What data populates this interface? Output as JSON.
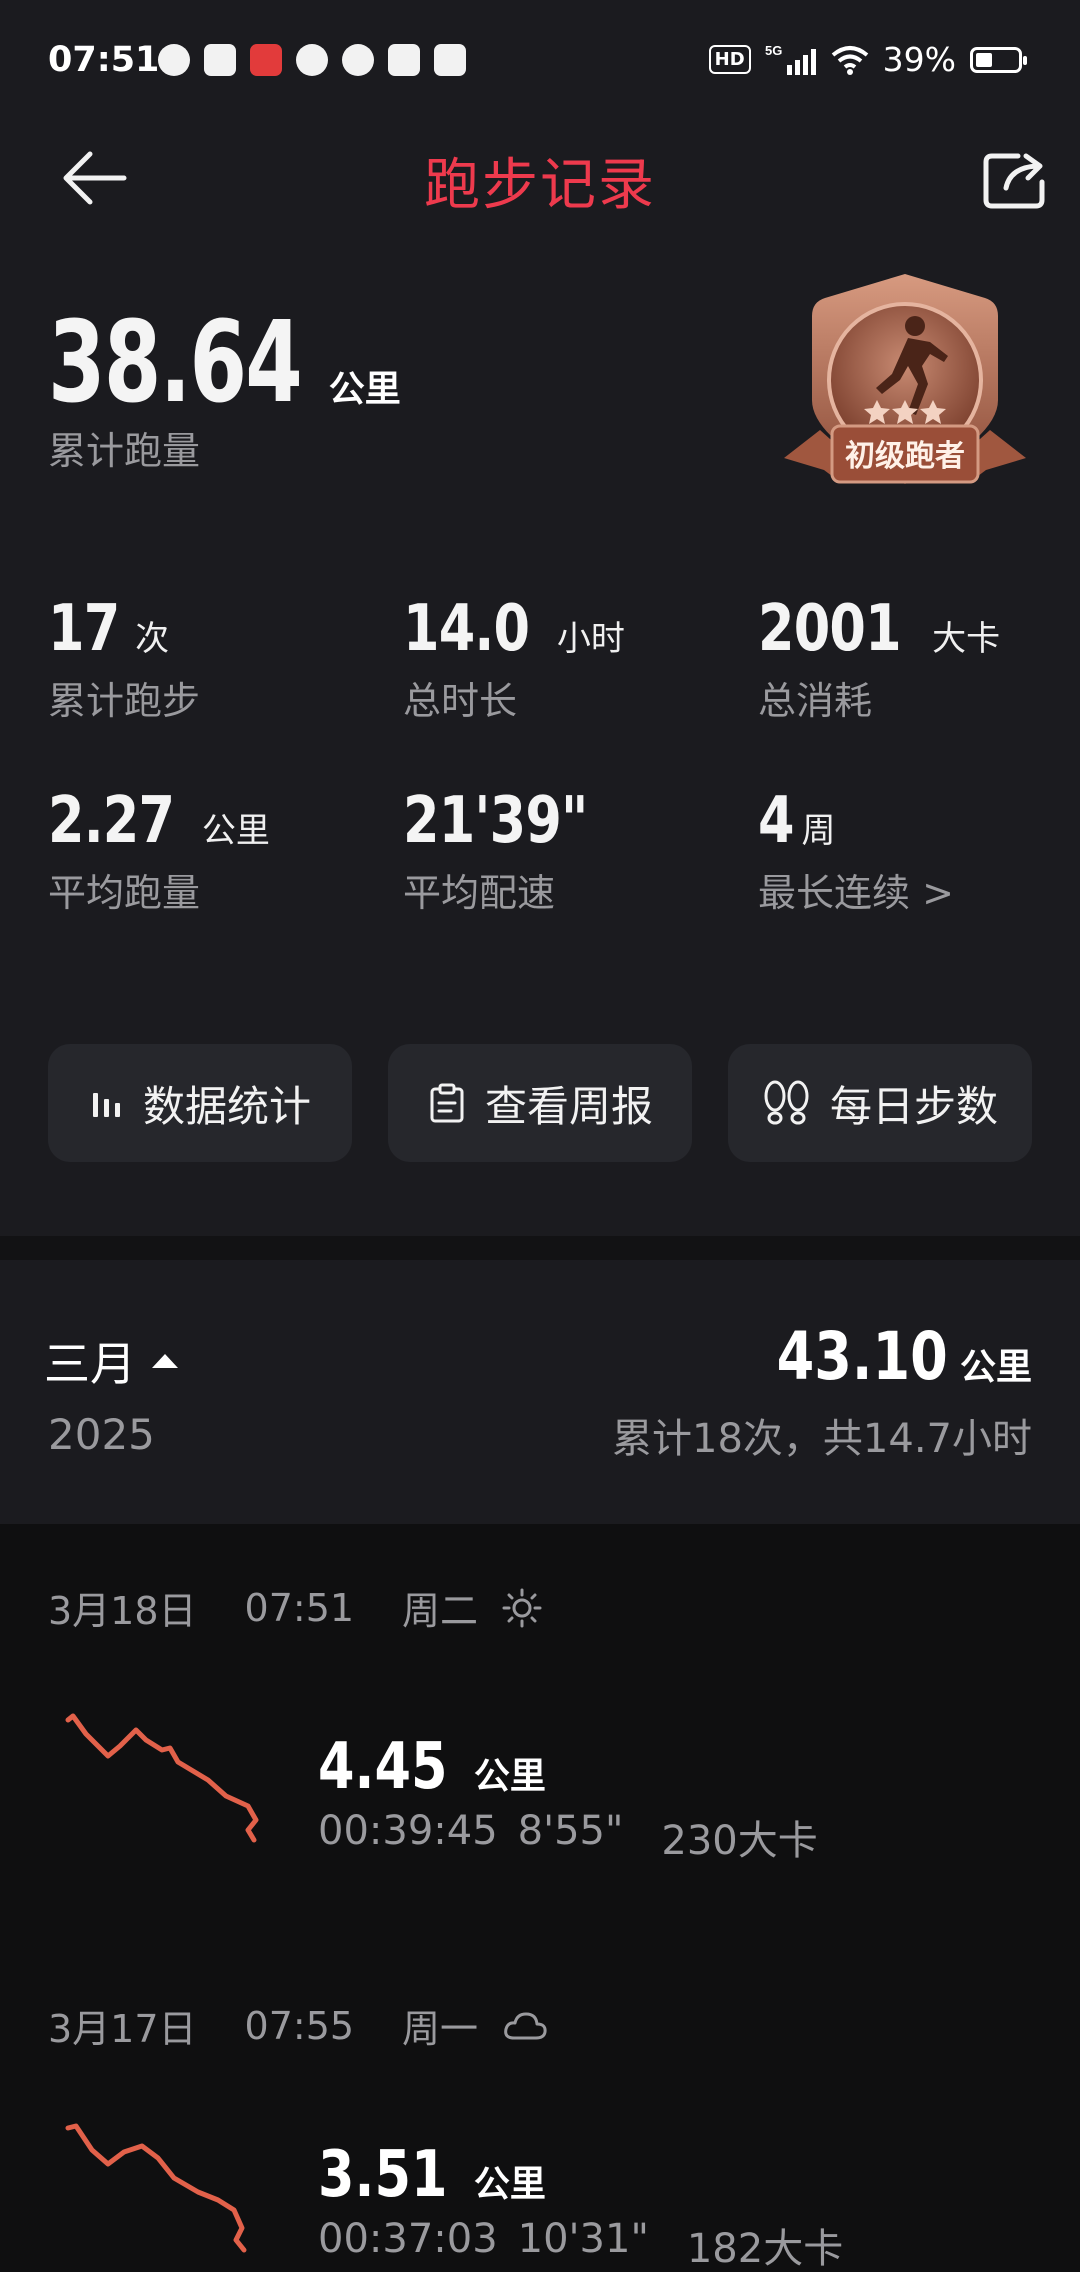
{
  "status_bar": {
    "time": "07:51",
    "network": "5G",
    "hd": "HD",
    "battery": "39%"
  },
  "header": {
    "title": "跑步记录",
    "back_icon": "back-arrow-icon",
    "share_icon": "share-icon"
  },
  "summary": {
    "total_distance": "38.64",
    "total_unit": "公里",
    "total_label": "累计跑量",
    "badge_title": "初级跑者",
    "badge_stars": 3
  },
  "stats": [
    {
      "value": "17",
      "unit": "次",
      "label": "累计跑步"
    },
    {
      "value": "14.0",
      "unit": "小时",
      "label": "总时长"
    },
    {
      "value": "2001",
      "unit": "大卡",
      "label": "总消耗"
    },
    {
      "value": "2.27",
      "unit": "公里",
      "label": "平均跑量"
    },
    {
      "value": "21'39\"",
      "unit": "",
      "label": "平均配速"
    },
    {
      "value": "4",
      "unit": "周",
      "label": "最长连续 >"
    }
  ],
  "actions": [
    {
      "label": "数据统计",
      "icon": "bar-chart-icon"
    },
    {
      "label": "查看周报",
      "icon": "clipboard-icon"
    },
    {
      "label": "每日步数",
      "icon": "footprints-icon"
    }
  ],
  "month": {
    "name": "三月",
    "year": "2025",
    "distance": "43.10",
    "unit": "公里",
    "summary": "累计18次，共14.7小时"
  },
  "runs": [
    {
      "date": "3月18日",
      "time": "07:51",
      "weekday": "周二",
      "weather_icon": "sun-icon",
      "distance": "4.45",
      "unit": "公里",
      "duration": "00:39:45",
      "pace": "8'55\"",
      "calories": "230大卡"
    },
    {
      "date": "3月17日",
      "time": "07:55",
      "weekday": "周一",
      "weather_icon": "cloud-icon",
      "distance": "3.51",
      "unit": "公里",
      "duration": "00:37:03",
      "pace": "10'31\"",
      "calories": "182大卡"
    }
  ],
  "colors": {
    "accent": "#ee3a4d",
    "route": "#e2614a",
    "badge": "#b0705a",
    "background": "#1b1b1f"
  }
}
